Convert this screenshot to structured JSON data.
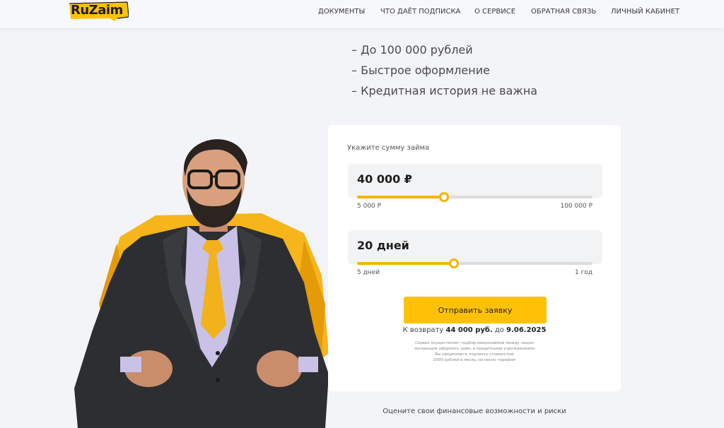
{
  "header": {
    "logo_text": "RuZaim",
    "nav": [
      {
        "label": "ДОКУМЕНТЫ"
      },
      {
        "label": "ЧТО ДАЁТ ПОДПИСКА"
      },
      {
        "label": "О СЕРВИСЕ"
      },
      {
        "label": "ОБРАТНАЯ СВЯЗЬ"
      },
      {
        "label": "ЛИЧНЫЙ КАБИНЕТ"
      }
    ]
  },
  "features": [
    "– До 100 000 рублей",
    "– Быстрое оформление",
    "– Кредитная история не важна"
  ],
  "form": {
    "label": "Укажите сумму займа",
    "amount": {
      "value": "40 000 ₽",
      "min": "5 000 Р",
      "max": "100 000 Р",
      "fill_fraction": 0.37
    },
    "term": {
      "value": "20 дней",
      "min": "5 дней",
      "max": "1 год",
      "fill_fraction": 0.41
    },
    "submit_label": "Отправить заявку",
    "return": {
      "prefix": "К возврату",
      "amount": "44 000 руб.",
      "middle": "до",
      "date": "9.06.2025"
    },
    "disclaimer": [
      "Сервис осуществляет подбор микрозаймов между лицом",
      "желающим оформить займ, и кредитными учреждениями",
      "Вы оформляете подписку стоимостью",
      "2000 рублей в месяц согласно тарифам"
    ]
  },
  "footer": {
    "text": "Оцените свои финансовые возможности и риски"
  },
  "colors": {
    "accent": "#ffc107",
    "slider": "#f5b400",
    "background": "#f3f4f8"
  }
}
